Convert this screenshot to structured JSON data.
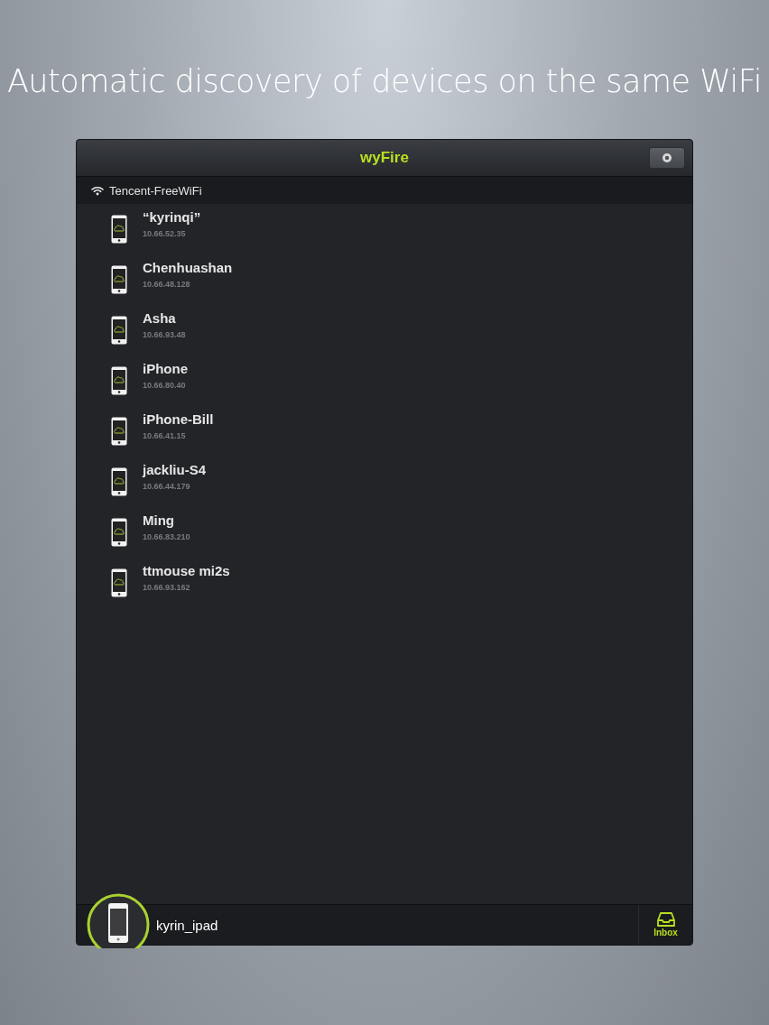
{
  "headline": "Automatic discovery of devices on the same WiFi",
  "window": {
    "title": "wyFire"
  },
  "network": {
    "name": "Tencent-FreeWiFi"
  },
  "devices": [
    {
      "name": "“kyrinqi”",
      "ip": "10.66.52.35"
    },
    {
      "name": "Chenhuashan",
      "ip": "10.66.48.128"
    },
    {
      "name": "Asha",
      "ip": "10.66.93.48"
    },
    {
      "name": "iPhone",
      "ip": "10.66.80.40"
    },
    {
      "name": "iPhone-Bill",
      "ip": "10.66.41.15"
    },
    {
      "name": "jackliu-S4",
      "ip": "10.66.44.179"
    },
    {
      "name": "Ming",
      "ip": "10.66.83.210"
    },
    {
      "name": "ttmouse mi2s",
      "ip": "10.66.93.162"
    }
  ],
  "bottom_bar": {
    "device_name": "kyrin_ipad",
    "inbox_label": "Inbox"
  }
}
